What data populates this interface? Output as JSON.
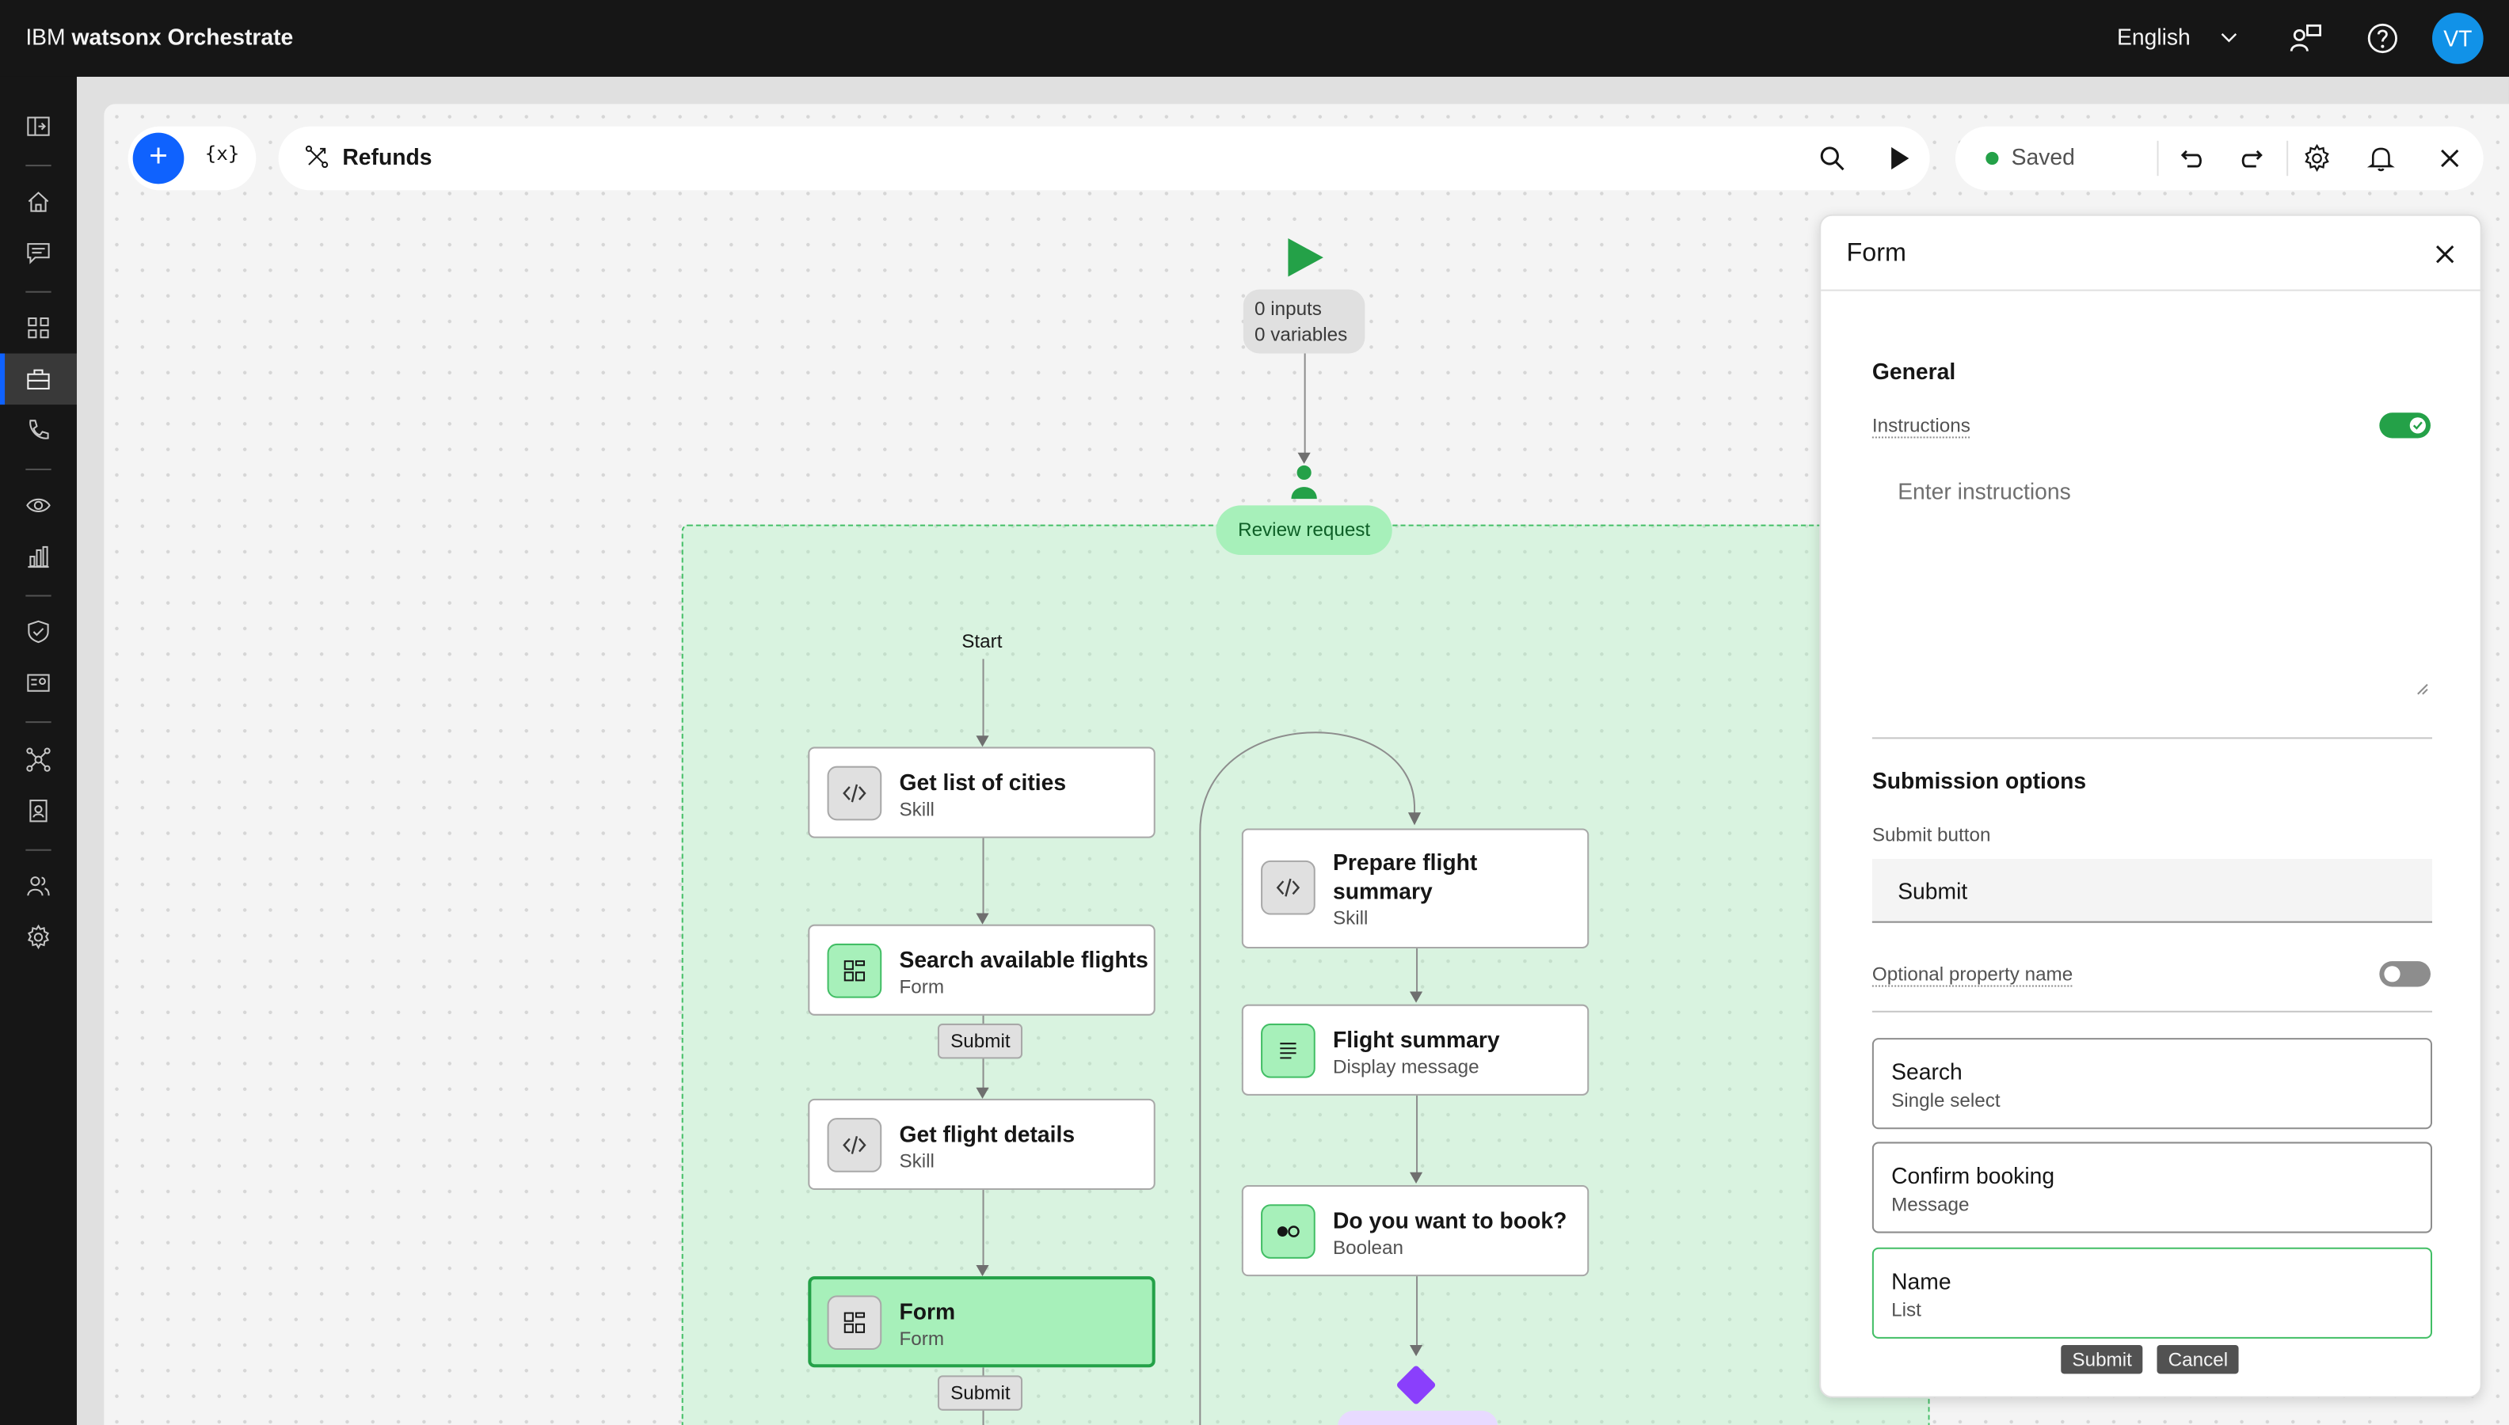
{
  "header": {
    "brand_prefix": "IBM ",
    "brand_name": "watsonx Orchestrate",
    "language": "English",
    "avatar_initials": "VT"
  },
  "toolbar": {
    "variables_label": "{x}",
    "flow_name": "Refunds",
    "status": "Saved"
  },
  "flow": {
    "start_io": {
      "inputs": "0 inputs",
      "variables": "0 variables"
    },
    "review_label": "Review request",
    "start_label": "Start",
    "left_nodes": [
      {
        "title": "Get list of cities",
        "type": "Skill"
      },
      {
        "title": "Search available flights",
        "type": "Form"
      },
      {
        "title": "Get flight details",
        "type": "Skill"
      },
      {
        "title": "Form",
        "type": "Form"
      }
    ],
    "right_nodes": [
      {
        "title_line1": "Prepare flight",
        "title_line2": "summary",
        "type": "Skill"
      },
      {
        "title": "Flight summary",
        "type": "Display message"
      },
      {
        "title": "Do you want to book?",
        "type": "Boolean"
      }
    ],
    "submit_chip": "Submit"
  },
  "panel": {
    "title": "Form",
    "general_title": "General",
    "instructions_label": "Instructions",
    "instructions_placeholder": "Enter instructions",
    "instructions_enabled": true,
    "submission_title": "Submission options",
    "submit_button_label": "Submit button",
    "submit_button_value": "Submit",
    "optional_property_label": "Optional property name",
    "optional_property_enabled": false,
    "fields": [
      {
        "title": "Search",
        "type": "Single select"
      },
      {
        "title": "Confirm booking",
        "type": "Message"
      },
      {
        "title": "Name",
        "type": "List"
      }
    ],
    "submit_action": "Submit",
    "cancel_action": "Cancel"
  },
  "colors": {
    "accent": "#0f62fe",
    "success": "#24a148",
    "region_fill": "#a7f0ba",
    "decision": "#8a3ffc",
    "avatar": "#1192e8"
  }
}
